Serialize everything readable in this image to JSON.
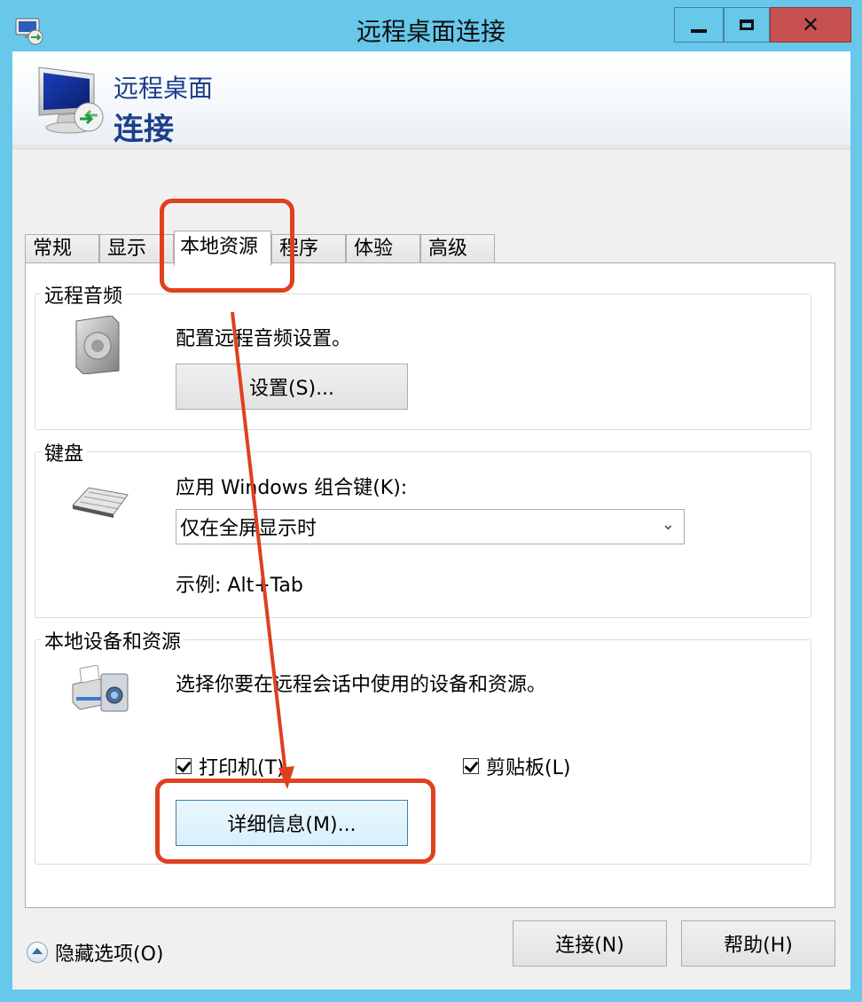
{
  "window": {
    "title": "远程桌面连接",
    "close_glyph": "✕"
  },
  "banner": {
    "subtitle": "远程桌面",
    "title": "连接"
  },
  "tabs": [
    {
      "label": "常规",
      "active": false
    },
    {
      "label": "显示",
      "active": false
    },
    {
      "label": "本地资源",
      "active": true
    },
    {
      "label": "程序",
      "active": false
    },
    {
      "label": "体验",
      "active": false
    },
    {
      "label": "高级",
      "active": false
    }
  ],
  "remote_audio": {
    "title": "远程音频",
    "description": "配置远程音频设置。",
    "settings_button": "设置(S)..."
  },
  "keyboard": {
    "title": "键盘",
    "label": "应用 Windows 组合键(K):",
    "selected": "仅在全屏显示时",
    "example": "示例: Alt+Tab"
  },
  "local_devices": {
    "title": "本地设备和资源",
    "description": "选择你要在远程会话中使用的设备和资源。",
    "printer": {
      "label": "打印机(T)",
      "checked": true
    },
    "clipboard": {
      "label": "剪贴板(L)",
      "checked": true
    },
    "more_button": "详细信息(M)..."
  },
  "footer": {
    "hide_options": "隐藏选项(O)",
    "connect": "连接(N)",
    "help": "帮助(H)"
  },
  "colors": {
    "titlebar": "#67c8ea",
    "close_button": "#c75050",
    "banner_text": "#1d3f8a",
    "annotation": "#e0401e"
  },
  "icons": {
    "app": "remote-desktop-icon",
    "banner": "monitor-connection-icon",
    "audio": "speaker-icon",
    "keyboard": "keyboard-icon",
    "devices": "printer-camera-icon"
  }
}
